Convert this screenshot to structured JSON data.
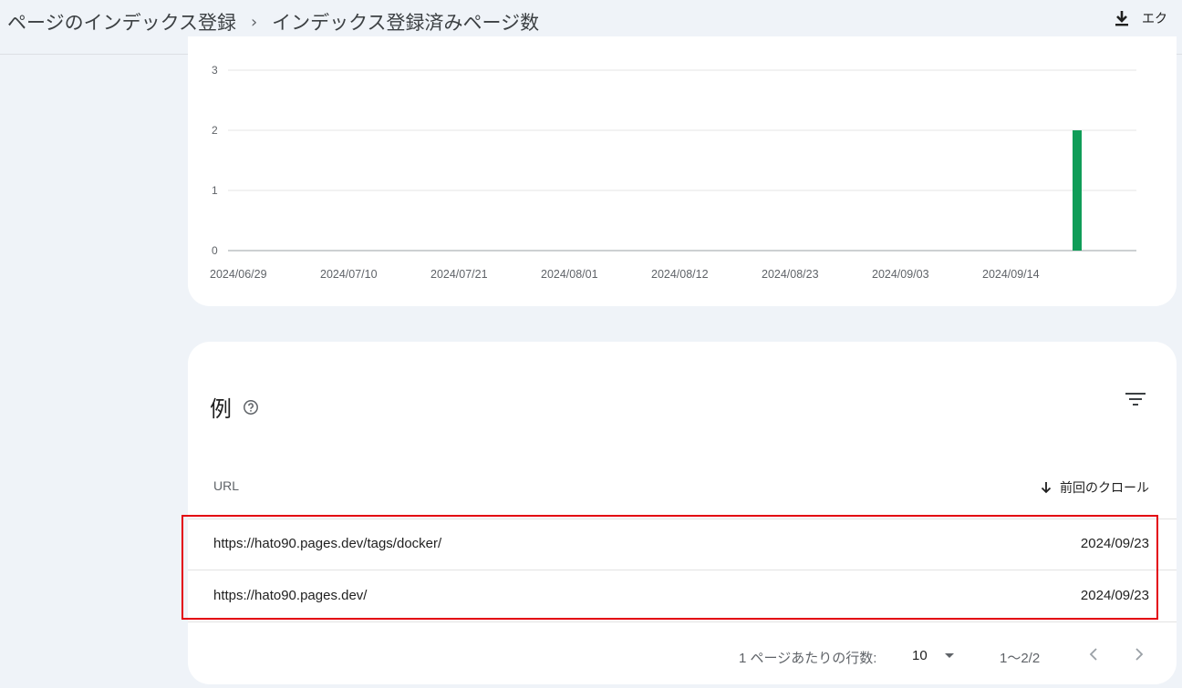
{
  "header": {
    "breadcrumb_parent": "ページのインデックス登録",
    "breadcrumb_separator": "›",
    "breadcrumb_current": "インデックス登録済みページ数",
    "export_label": "エク"
  },
  "chart_data": {
    "type": "bar",
    "y_ticks": [
      "0",
      "1",
      "2",
      "3"
    ],
    "ylim": [
      0,
      3
    ],
    "x_ticks": [
      "2024/06/29",
      "2024/07/10",
      "2024/07/21",
      "2024/08/01",
      "2024/08/12",
      "2024/08/23",
      "2024/09/03",
      "2024/09/14"
    ],
    "series": [
      {
        "color": "#0f9d58",
        "points": [
          {
            "x": "2024/09/23",
            "y": 2
          }
        ]
      }
    ]
  },
  "table": {
    "title": "例",
    "columns": {
      "url": "URL",
      "last_crawl": "前回のクロール"
    },
    "rows": [
      {
        "url": "https://hato90.pages.dev/tags/docker/",
        "date": "2024/09/23"
      },
      {
        "url": "https://hato90.pages.dev/",
        "date": "2024/09/23"
      }
    ],
    "pagination": {
      "rows_per_page_label": "1 ページあたりの行数:",
      "rows_per_page": "10",
      "range": "1〜2/2"
    }
  },
  "colors": {
    "accent": "#0f9d58",
    "highlight": "#e3000f",
    "background": "#eff3f8"
  }
}
